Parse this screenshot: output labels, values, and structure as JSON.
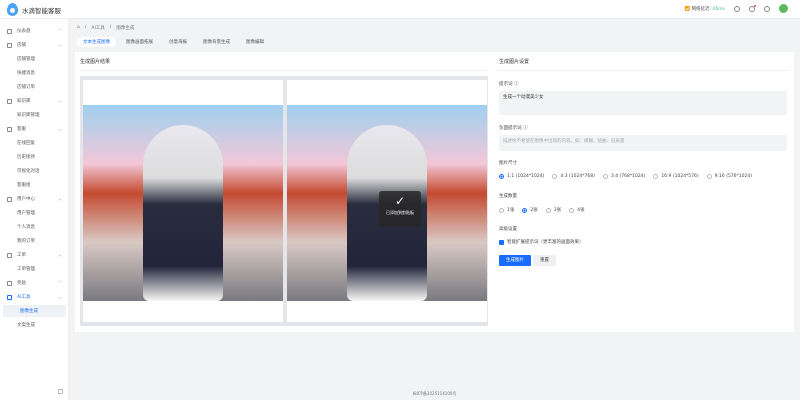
{
  "app": {
    "title": "水滴智能客服"
  },
  "header": {
    "ping_label": "网络延迟:",
    "ping_value": "26ms"
  },
  "sidebar": {
    "items": [
      {
        "label": "仪表盘",
        "type": "group",
        "expanded": false
      },
      {
        "label": "店铺",
        "type": "group",
        "expanded": true
      },
      {
        "label": "店铺管理",
        "type": "sub"
      },
      {
        "label": "快捷消息",
        "type": "sub"
      },
      {
        "label": "店铺订单",
        "type": "sub"
      },
      {
        "label": "知识库",
        "type": "group",
        "expanded": true
      },
      {
        "label": "知识库管理",
        "type": "sub"
      },
      {
        "label": "客服",
        "type": "group",
        "expanded": true
      },
      {
        "label": "在线回复",
        "type": "sub"
      },
      {
        "label": "历史接待",
        "type": "sub"
      },
      {
        "label": "可视化对话",
        "type": "sub"
      },
      {
        "label": "客服组",
        "type": "sub"
      },
      {
        "label": "用户中心",
        "type": "group",
        "expanded": true
      },
      {
        "label": "用户管理",
        "type": "sub"
      },
      {
        "label": "个人消息",
        "type": "sub"
      },
      {
        "label": "我的订单",
        "type": "sub"
      },
      {
        "label": "工单",
        "type": "group",
        "expanded": true
      },
      {
        "label": "工单管理",
        "type": "sub"
      },
      {
        "label": "奖励",
        "type": "group",
        "expanded": false
      },
      {
        "label": "AI工具",
        "type": "group",
        "expanded": true
      },
      {
        "label": "图像生成",
        "type": "sub",
        "active": true
      },
      {
        "label": "文案生成",
        "type": "sub"
      }
    ]
  },
  "breadcrumb": [
    "AI工具",
    "图像生成"
  ],
  "tabs": [
    "文本生成图像",
    "图像画面拓展",
    "创意海报",
    "图像背景生成",
    "图像编辑"
  ],
  "result": {
    "title": "生成图片结果",
    "toast": "已添加到剪贴板"
  },
  "settings": {
    "title": "生成图片设置",
    "prompt_label": "提示词",
    "prompt_value": "生成一个动漫美少女",
    "neg_label": "负面提示词",
    "neg_placeholder": "描述你不希望在图像中出现的内容，如：模糊、扭曲、低质量",
    "size_label": "图片尺寸",
    "sizes": [
      "1:1 (1024*1024)",
      "4:3 (1024*768)",
      "3:4 (768*1024)",
      "16:9 (1024*576)",
      "9:16 (576*1024)"
    ],
    "count_label": "生成数量",
    "counts": [
      "1张",
      "2张",
      "3张",
      "4张"
    ],
    "advanced_label": "高级设置",
    "smart_expand": "智能扩展提示词（更丰富的画面效果）",
    "generate": "生成图片",
    "reset": "重置"
  },
  "footer": "闽ICP备2025114100号",
  "colors": {
    "accent": "#1a6cff",
    "ping": "#3cc47c"
  }
}
